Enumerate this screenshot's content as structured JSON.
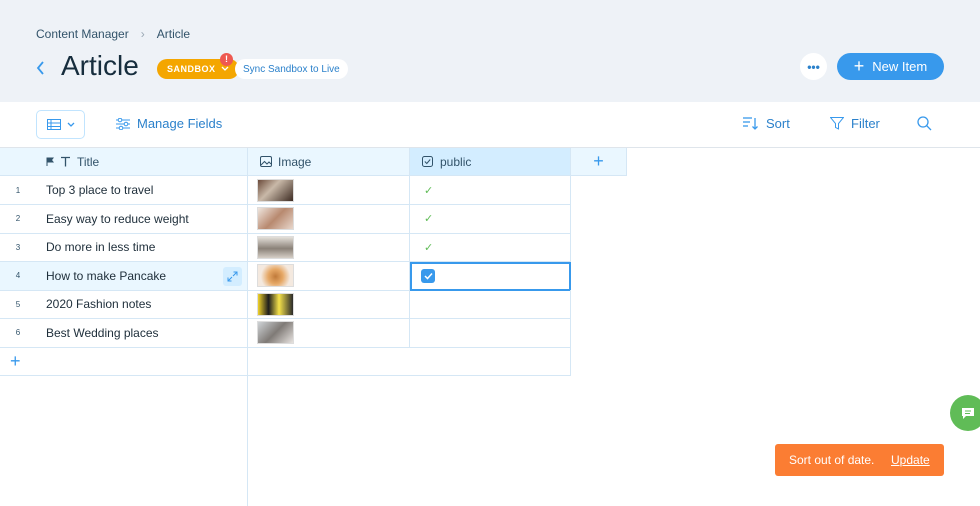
{
  "breadcrumb": {
    "root": "Content Manager",
    "current": "Article"
  },
  "header": {
    "title": "Article",
    "sandbox_label": "SANDBOX",
    "alert": "!",
    "sync_label": "Sync Sandbox to Live",
    "more_label": "•••",
    "new_item_label": "New Item"
  },
  "toolbar": {
    "manage_fields": "Manage Fields",
    "sort": "Sort",
    "filter": "Filter"
  },
  "columns": {
    "title": "Title",
    "image": "Image",
    "public": "public"
  },
  "rows": [
    {
      "num": "1",
      "title": "Top 3 place to travel",
      "public": "checked"
    },
    {
      "num": "2",
      "title": "Easy way to reduce weight",
      "public": "checked"
    },
    {
      "num": "3",
      "title": "Do more in less time",
      "public": "checked"
    },
    {
      "num": "4",
      "title": "How to make Pancake",
      "public": "editing-checked"
    },
    {
      "num": "5",
      "title": "2020 Fashion notes",
      "public": ""
    },
    {
      "num": "6",
      "title": "Best Wedding places",
      "public": ""
    }
  ],
  "check_glyph": "✓",
  "toast": {
    "message": "Sort out of date.",
    "action": "Update"
  },
  "colors": {
    "accent": "#3899ec",
    "sandbox": "#f4a600",
    "toast": "#fb7d33",
    "chat": "#60bc57",
    "check": "#60bc57"
  }
}
